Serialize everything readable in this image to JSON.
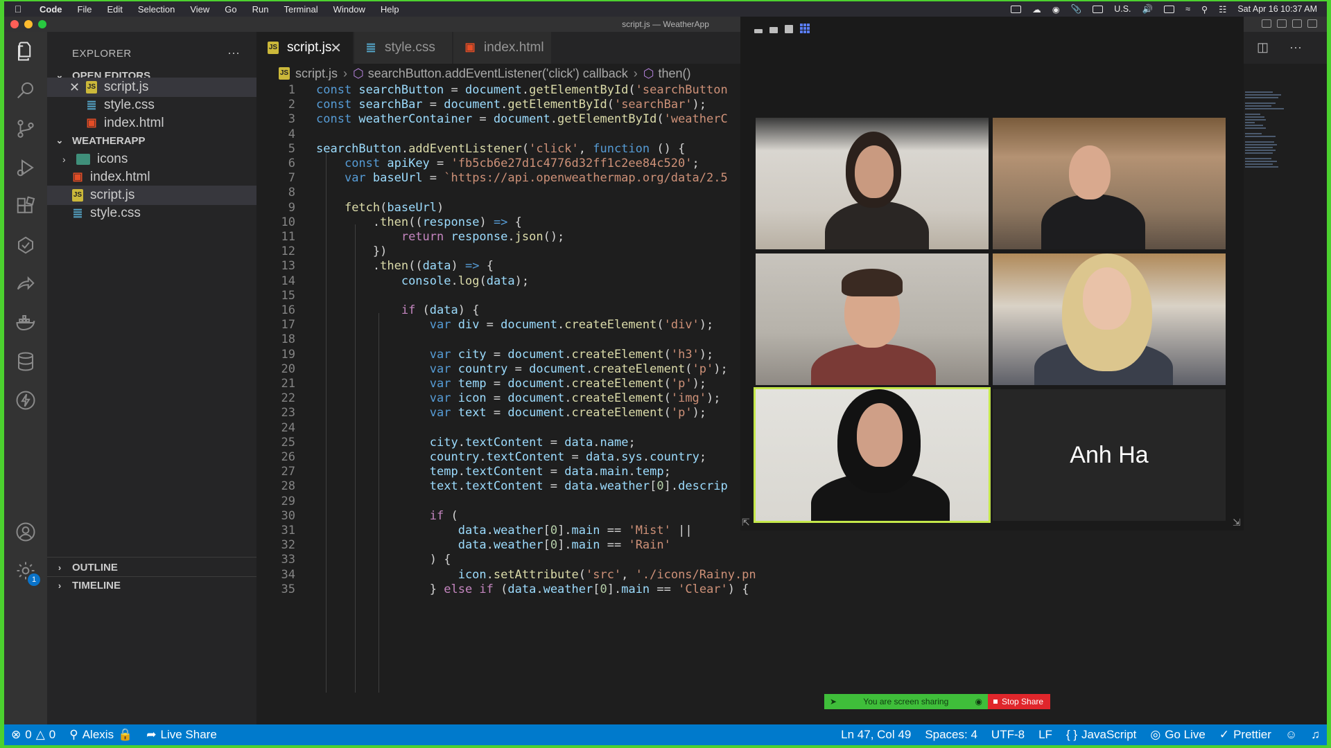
{
  "menubar": {
    "app": "Code",
    "items": [
      "File",
      "Edit",
      "Selection",
      "View",
      "Go",
      "Run",
      "Terminal",
      "Window",
      "Help"
    ],
    "input_source": "U.S.",
    "datetime": "Sat Apr 16  10:37 AM"
  },
  "window": {
    "title": "script.js — WeatherApp"
  },
  "sidebar": {
    "title": "EXPLORER",
    "more": "···",
    "open_editors_label": "OPEN EDITORS",
    "open_editors": [
      {
        "name": "script.js",
        "type": "js"
      },
      {
        "name": "style.css",
        "type": "css"
      },
      {
        "name": "index.html",
        "type": "html"
      }
    ],
    "project_label": "WEATHERAPP",
    "files": [
      {
        "name": "icons",
        "type": "folder"
      },
      {
        "name": "index.html",
        "type": "html"
      },
      {
        "name": "script.js",
        "type": "js"
      },
      {
        "name": "style.css",
        "type": "css"
      }
    ],
    "outline_label": "OUTLINE",
    "timeline_label": "TIMELINE"
  },
  "tabs": [
    {
      "label": "script.js",
      "type": "js"
    },
    {
      "label": "style.css",
      "type": "css"
    },
    {
      "label": "index.html",
      "type": "html"
    }
  ],
  "breadcrumb": {
    "file": "script.js",
    "scope": "searchButton.addEventListener('click') callback",
    "fn": "then()"
  },
  "settings_badge": "1",
  "zoom": {
    "participant_name": "Anh Ha"
  },
  "share": {
    "status": "You are screen sharing",
    "stop": "Stop Share"
  },
  "statusbar": {
    "errors": "0",
    "warnings": "0",
    "user": "Alexis",
    "live_share": "Live Share",
    "position": "Ln 47, Col 49",
    "spaces": "Spaces: 4",
    "encoding": "UTF-8",
    "eol": "LF",
    "language": "JavaScript",
    "go_live": "Go Live",
    "prettier": "Prettier"
  },
  "colors": {
    "accent": "#007acc",
    "share_green": "#3fbe3a",
    "share_red": "#e0262b",
    "active_tile": "#c5e84a"
  }
}
